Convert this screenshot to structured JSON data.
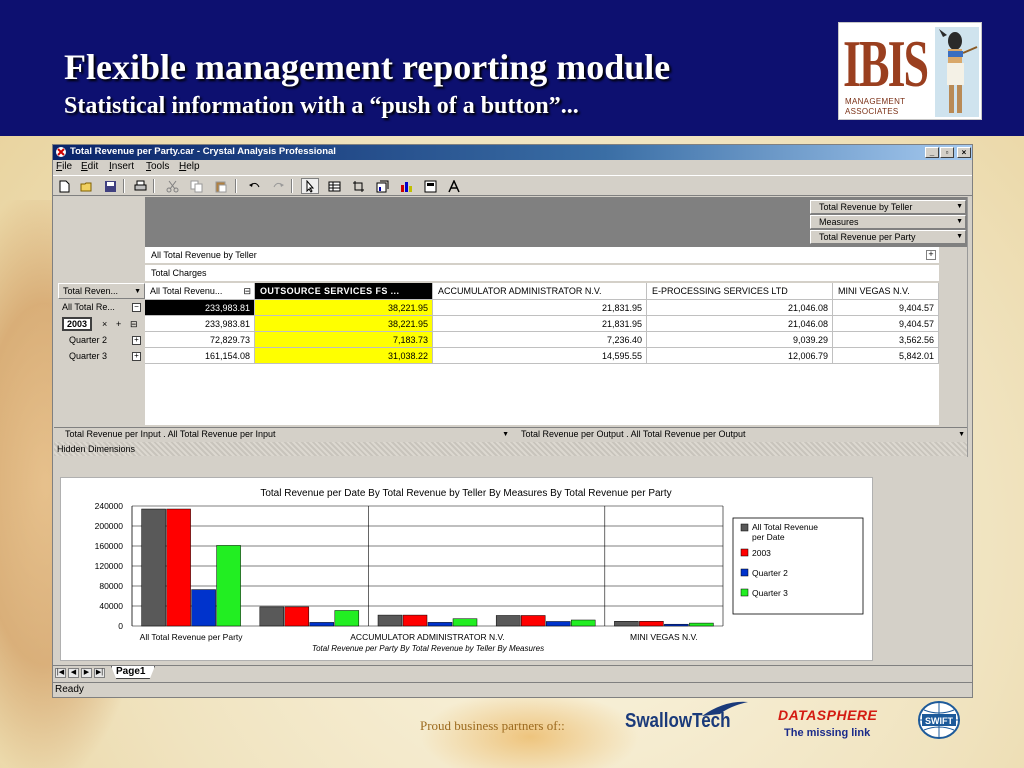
{
  "slide": {
    "title": "Flexible management reporting module",
    "subtitle": "Statistical information with a “push of a button”...",
    "logo": {
      "mark": "IBIS",
      "line1": "MANAGEMENT",
      "line2": "ASSOCIATES"
    },
    "footer": {
      "partners_text": "Proud business partners of::",
      "swallowtech": "SwallowTech",
      "datasphere": "DATASPHERE",
      "datasphere_tagline": "The missing link",
      "swift": "SWIFT"
    }
  },
  "window": {
    "title": "Total Revenue per Party.car - Crystal Analysis Professional",
    "controls": [
      "_",
      "▫",
      "×"
    ],
    "menu": [
      {
        "label": "File",
        "key": "F"
      },
      {
        "label": "Edit",
        "key": "E"
      },
      {
        "label": "Insert",
        "key": "I"
      },
      {
        "label": "Tools",
        "key": "T"
      },
      {
        "label": "Help",
        "key": "H"
      }
    ],
    "toolbar_icons": [
      "new-icon",
      "open-icon",
      "save-icon",
      "print-icon",
      "cut-icon",
      "copy-icon",
      "paste-icon",
      "undo-icon",
      "redo-icon",
      "pointer-icon",
      "grid-icon",
      "chart-crop-icon",
      "chart-wizard-icon",
      "bar-chart-icon",
      "data-icon",
      "text-icon"
    ]
  },
  "pivot": {
    "filters": [
      "Total Revenue by Teller",
      "Measures",
      "Total Revenue per Party"
    ],
    "column_dim_1": "All Total Revenue by Teller",
    "column_dim_2": "Total Charges",
    "row_dim_button": "Total Reven...",
    "corner_header": "All Total Revenu...",
    "column_headers": [
      "OUTSOURCE SERVICES FS ...",
      "ACCUMULATOR ADMINISTRATOR N.V.",
      "E-PROCESSING SERVICES LTD",
      "MINI VEGAS N.V."
    ],
    "rows": [
      {
        "label": "All Total Re...",
        "values": [
          "233,983.81",
          "38,221.95",
          "21,831.95",
          "21,046.08",
          "9,404.57"
        ]
      },
      {
        "label": "2003",
        "values": [
          "233,983.81",
          "38,221.95",
          "21,831.95",
          "21,046.08",
          "9,404.57"
        ]
      },
      {
        "label": "Quarter 2",
        "values": [
          "72,829.73",
          "7,183.73",
          "7,236.40",
          "9,039.29",
          "3,562.56"
        ]
      },
      {
        "label": "Quarter 3",
        "values": [
          "161,154.08",
          "31,038.22",
          "14,595.55",
          "12,006.79",
          "5,842.01"
        ]
      }
    ],
    "row_2003_controls": [
      "×",
      "+",
      "⊟"
    ],
    "bottom_left": "Total Revenue per Input . All Total Revenue per Input",
    "bottom_right": "Total Revenue per Output . All Total Revenue per Output",
    "hidden_dimensions": "Hidden Dimensions"
  },
  "chart_data": {
    "type": "bar",
    "title": "Total Revenue per Date By Total Revenue by Teller By Measures By Total Revenue per Party",
    "xlabel": "Total Revenue per Party By Total Revenue by Teller By Measures",
    "ylabel": "",
    "ylim": [
      0,
      240000
    ],
    "yticks": [
      "240000",
      "200000",
      "160000",
      "120000",
      "80000",
      "40000",
      "0"
    ],
    "grid": true,
    "legend_position": "right",
    "categories": [
      "All Total Revenue per Party",
      "OUTSOURCE SERVICES FS",
      "ACCUMULATOR ADMINISTRATOR N.V.",
      "E-PROCESSING SERVICES LTD",
      "MINI VEGAS N.V."
    ],
    "category_labels_shown": [
      "All Total Revenue per Party",
      "",
      "ACCUMULATOR ADMINISTRATOR N.V.",
      "",
      "MINI VEGAS N.V."
    ],
    "series": [
      {
        "name": "All Total Revenue per Date",
        "color": "#595959",
        "values": [
          233983.81,
          38221.95,
          21831.95,
          21046.08,
          9404.57
        ]
      },
      {
        "name": "2003",
        "color": "#ff0000",
        "values": [
          233983.81,
          38221.95,
          21831.95,
          21046.08,
          9404.57
        ]
      },
      {
        "name": "Quarter 2",
        "color": "#0033cc",
        "values": [
          72829.73,
          7183.73,
          7236.4,
          9039.29,
          3562.56
        ]
      },
      {
        "name": "Quarter 3",
        "color": "#22ee22",
        "values": [
          161154.08,
          31038.22,
          14595.55,
          12006.79,
          5842.01
        ]
      }
    ]
  },
  "sheet": {
    "tab": "Page1"
  },
  "status": {
    "text": "Ready"
  },
  "colors": {
    "header_bg": "#0d1070",
    "highlight_yellow": "#ffff00",
    "title_bar": "#0a246a"
  }
}
